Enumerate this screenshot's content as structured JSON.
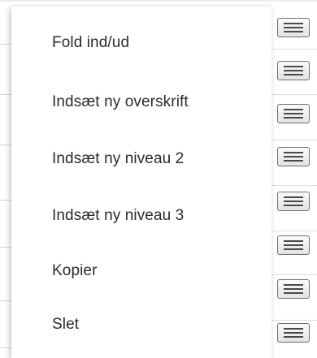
{
  "context_menu": {
    "items": [
      {
        "label": "Fold ind/ud"
      },
      {
        "label": "Indsæt ny overskrift"
      },
      {
        "label": "Indsæt ny niveau 2"
      },
      {
        "label": "Indsæt ny niveau 3"
      },
      {
        "label": "Kopier"
      },
      {
        "label": "Slet"
      }
    ]
  },
  "row_menu_buttons": {
    "icon": "hamburger-menu-icon",
    "count": 8
  },
  "colors": {
    "menu_text": "#2b2b2b",
    "button_border": "#6f6f6f",
    "button_bars": "#4a4a4a"
  }
}
